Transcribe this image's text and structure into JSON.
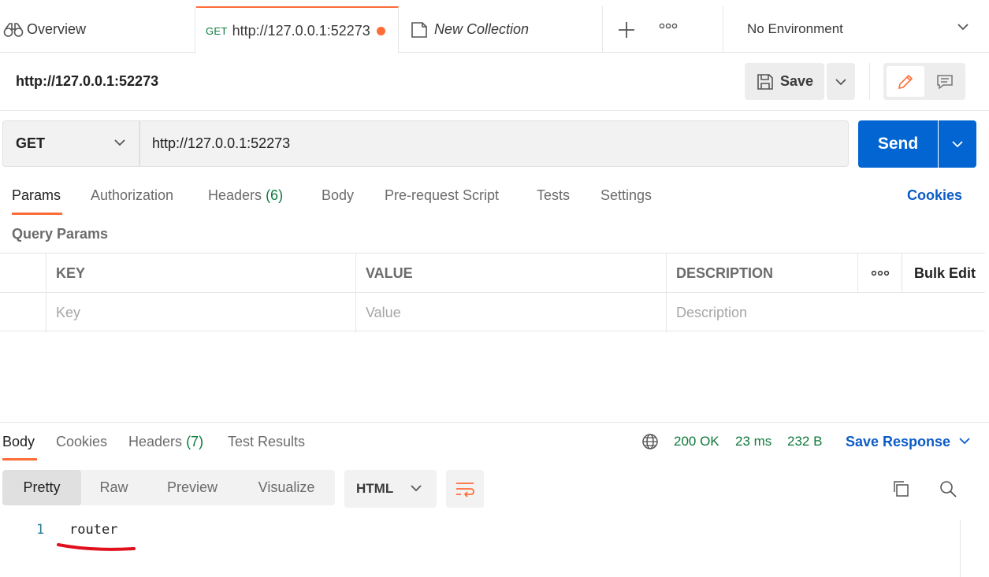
{
  "tabs": {
    "overview": "Overview",
    "request_method": "GET",
    "request_url": "http://127.0.0.1:52273",
    "collection": "New Collection",
    "environment": "No Environment"
  },
  "request": {
    "name": "http://127.0.0.1:52273",
    "save_label": "Save",
    "method": "GET",
    "url": "http://127.0.0.1:52273",
    "send_label": "Send"
  },
  "request_tabs": {
    "params": "Params",
    "authorization": "Authorization",
    "headers": "Headers",
    "headers_count": "(6)",
    "body": "Body",
    "prerequest": "Pre-request Script",
    "tests": "Tests",
    "settings": "Settings",
    "cookies": "Cookies"
  },
  "query_params": {
    "title": "Query Params",
    "columns": [
      "KEY",
      "VALUE",
      "DESCRIPTION"
    ],
    "bulk_edit": "Bulk Edit",
    "placeholders": [
      "Key",
      "Value",
      "Description"
    ]
  },
  "response": {
    "tabs": {
      "body": "Body",
      "cookies": "Cookies",
      "headers": "Headers",
      "headers_count": "(7)",
      "test_results": "Test Results"
    },
    "status": "200 OK",
    "time": "23 ms",
    "size": "232 B",
    "save_response": "Save Response",
    "views": [
      "Pretty",
      "Raw",
      "Preview",
      "Visualize"
    ],
    "format": "HTML",
    "lines": [
      {
        "num": "1",
        "text": "router"
      }
    ]
  },
  "colors": {
    "accent": "#ff6c37",
    "primary_blue": "#0265d2",
    "link_blue": "#0b5cc6",
    "success_green": "#0f7a3b",
    "annotation_red": "#e0101c"
  }
}
